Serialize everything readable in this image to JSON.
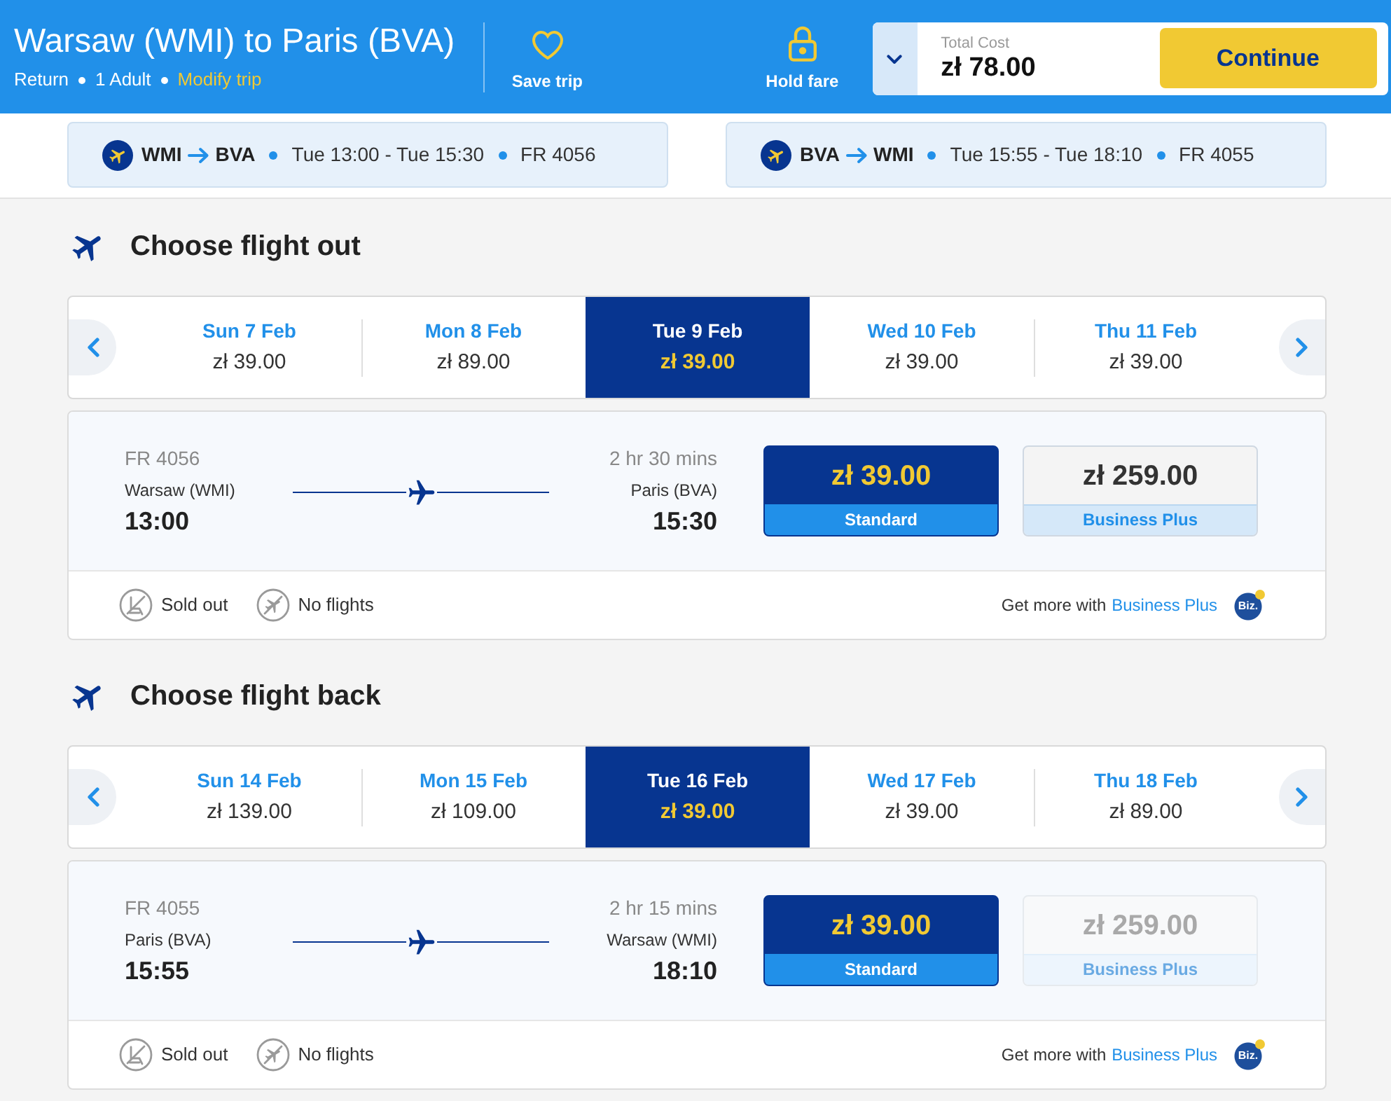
{
  "header": {
    "title": "Warsaw (WMI) to Paris (BVA)",
    "trip_details": [
      "Return",
      "1 Adult"
    ],
    "modify_link": "Modify trip",
    "actions": [
      {
        "kind": "heart",
        "label": "Save trip"
      },
      {
        "kind": "lock",
        "label": "Hold fare"
      }
    ],
    "total": {
      "label": "Total Cost",
      "amount": "zł 78.00",
      "expanded": false
    },
    "continue_button": "Continue"
  },
  "route_summaries": [
    {
      "from": "WMI",
      "to": "BVA",
      "times": "Tue 13:00 - Tue 15:30",
      "flight_number": "FR 4056"
    },
    {
      "from": "BVA",
      "to": "WMI",
      "times": "Tue 15:55 - Tue 18:10",
      "flight_number": "FR 4055"
    }
  ],
  "sections": [
    {
      "title": "Choose flight out",
      "dates": [
        {
          "date": "Sun 7 Feb",
          "price": "zł 39.00",
          "selected": false
        },
        {
          "date": "Mon 8 Feb",
          "price": "zł 89.00",
          "selected": false
        },
        {
          "date": "Tue 9 Feb",
          "price": "zł 39.00",
          "selected": true
        },
        {
          "date": "Wed 10 Feb",
          "price": "zł 39.00",
          "selected": false
        },
        {
          "date": "Thu 11 Feb",
          "price": "zł 39.00",
          "selected": false
        }
      ],
      "flight": {
        "number": "FR 4056",
        "origin": "Warsaw (WMI)",
        "departure": "13:00",
        "duration": "2 hr 30 mins",
        "destination": "Paris (BVA)",
        "arrival": "15:30"
      },
      "fares": [
        {
          "price": "zł 39.00",
          "name": "Standard",
          "selected": true,
          "disabled": false
        },
        {
          "price": "zł 259.00",
          "name": "Business Plus",
          "selected": false,
          "disabled": false
        }
      ],
      "legend": [
        {
          "kind": "sold_out",
          "label": "Sold out"
        },
        {
          "kind": "no_flights",
          "label": "No flights"
        }
      ],
      "promo": {
        "text": "Get more with",
        "link": "Business Plus",
        "badge": "Biz."
      }
    },
    {
      "title": "Choose flight back",
      "dates": [
        {
          "date": "Sun 14 Feb",
          "price": "zł 139.00",
          "selected": false
        },
        {
          "date": "Mon 15 Feb",
          "price": "zł 109.00",
          "selected": false
        },
        {
          "date": "Tue 16 Feb",
          "price": "zł 39.00",
          "selected": true
        },
        {
          "date": "Wed 17 Feb",
          "price": "zł 39.00",
          "selected": false
        },
        {
          "date": "Thu 18 Feb",
          "price": "zł 89.00",
          "selected": false
        }
      ],
      "flight": {
        "number": "FR 4055",
        "origin": "Paris (BVA)",
        "departure": "15:55",
        "duration": "2 hr 15 mins",
        "destination": "Warsaw (WMI)",
        "arrival": "18:10"
      },
      "fares": [
        {
          "price": "zł 39.00",
          "name": "Standard",
          "selected": true,
          "disabled": false
        },
        {
          "price": "zł 259.00",
          "name": "Business Plus",
          "selected": false,
          "disabled": true
        }
      ],
      "legend": [
        {
          "kind": "sold_out",
          "label": "Sold out"
        },
        {
          "kind": "no_flights",
          "label": "No flights"
        }
      ],
      "promo": {
        "text": "Get more with",
        "link": "Business Plus",
        "badge": "Biz."
      }
    }
  ]
}
